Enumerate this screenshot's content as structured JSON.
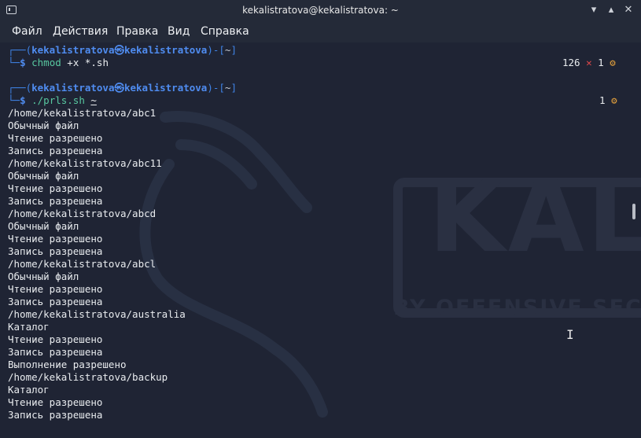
{
  "window": {
    "title": "kekalistratova@kekalistratova: ~",
    "controls": [
      "▾",
      "▴",
      "✕"
    ]
  },
  "menu": [
    "Файл",
    "Действия",
    "Правка",
    "Вид",
    "Справка"
  ],
  "watermark": {
    "brand": "KAL",
    "tagline": "BY OFFENSIVE SECU"
  },
  "prompts": [
    {
      "user_host": "kekalistratova㉿kekalistratova",
      "dir": "~",
      "command": "chmod",
      "args": "+x *.sh",
      "status_code": "126",
      "status_x": "✕",
      "jobs": "1"
    },
    {
      "user_host": "kekalistratova㉿kekalistratova",
      "dir": "~",
      "command": "./prls.sh",
      "args": "~",
      "jobs": "1"
    }
  ],
  "output": [
    "/home/kekalistratova/abc1",
    "Обычный файл",
    "Чтение разрешено",
    "Запись разрешена",
    "/home/kekalistratova/abc11",
    "Обычный файл",
    "Чтение разрешено",
    "Запись разрешена",
    "/home/kekalistratova/abcd",
    "Обычный файл",
    "Чтение разрешено",
    "Запись разрешена",
    "/home/kekalistratova/abcl",
    "Обычный файл",
    "Чтение разрешено",
    "Запись разрешена",
    "/home/kekalistratova/australia",
    "Каталог",
    "Чтение разрешено",
    "Запись разрешена",
    "Выполнение разрешено",
    "/home/kekalistratova/backup",
    "Каталог",
    "Чтение разрешено",
    "Запись разрешена"
  ],
  "colors": {
    "background": "#1f2434",
    "prompt_blue": "#3f83e6",
    "error_red": "#e0484a",
    "gear_orange": "#e6a23c"
  },
  "icons": [
    "terminal-app-icon",
    "minimize-icon",
    "maximize-icon",
    "close-icon",
    "gear-icon",
    "text-cursor-icon"
  ]
}
